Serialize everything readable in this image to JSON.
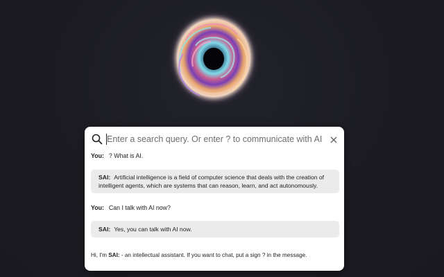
{
  "search": {
    "placeholder": "Enter a search query. Or enter ? to communicate with AI"
  },
  "conversation": [
    {
      "role": "user",
      "speaker": "You:",
      "text": "? What is AI."
    },
    {
      "role": "ai",
      "speaker": "SAI:",
      "text": "Artificial intelligence is a field of computer science that deals with the creation of intelligent agents, which are systems that can reason, learn, and act autonomously."
    },
    {
      "role": "user",
      "speaker": "You:",
      "text": "Can I talk with AI now?"
    },
    {
      "role": "ai",
      "speaker": "SAI:",
      "text": "Yes, you can talk with AI now."
    }
  ],
  "intro": {
    "prefix": "Hi, I'm ",
    "name": "SAI:",
    "suffix": " - an intellectual assistant. If you want to chat, put a sign ? in the message."
  },
  "icons": {
    "search": "search-icon",
    "close": "close-icon",
    "logo": "swirl-orb-logo"
  },
  "colors": {
    "background": "#1b1b21",
    "panel": "#ffffff",
    "ai_bubble": "#ebebeb"
  }
}
